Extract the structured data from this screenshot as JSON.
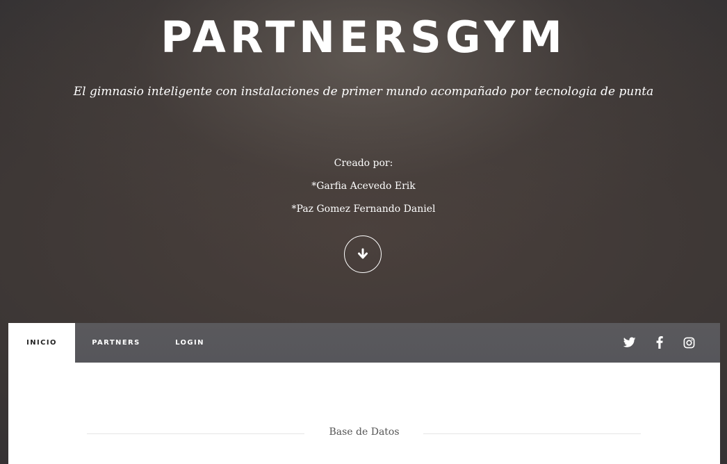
{
  "hero": {
    "title": "PARTNERSGYM",
    "tagline": "El gimnasio inteligente con instalaciones de primer mundo acompañado por tecnologia de punta",
    "credits_label": "Creado por:",
    "authors": [
      "*Garfia Acevedo Erik",
      "*Paz Gomez Fernando Daniel"
    ],
    "scroll_icon": "arrow-down-icon"
  },
  "nav": {
    "items": [
      {
        "label": "INICIO",
        "active": true
      },
      {
        "label": "PARTNERS",
        "active": false
      },
      {
        "label": "LOGIN",
        "active": false
      }
    ],
    "social_icons": [
      "twitter-icon",
      "facebook-icon",
      "instagram-icon"
    ]
  },
  "content": {
    "section_title": "Base de Datos"
  },
  "colors": {
    "navbar": "#57575b",
    "active_tab": "#ffffff",
    "text_light": "#ffffff",
    "text_dark": "#222222"
  }
}
